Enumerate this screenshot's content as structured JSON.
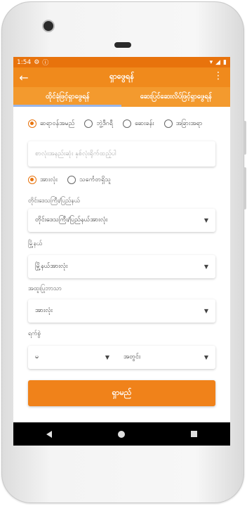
{
  "status": {
    "time": "1:54",
    "icons_left": [
      "gear-icon",
      "info-icon"
    ],
    "icons_right": [
      "wifi-icon",
      "signal-icon",
      "battery-icon"
    ]
  },
  "appbar": {
    "title": "ရှာဖွေရန်"
  },
  "tabs": [
    {
      "label": "ထိုင်ခုံဖြင့်ရှာဖွေရန်",
      "selected": true
    },
    {
      "label": "ဆေးပြင်ဆေးလိပ်ဖြင့်ရှာဖွေရန်",
      "selected": false
    }
  ],
  "search_type": {
    "options": [
      "ဆရာဝန်အမည်",
      "ဘွဲ့ဒီဂရီ",
      "ဆေးခန်း",
      "အခြားအရာ"
    ],
    "selected_index": 0
  },
  "search": {
    "placeholder": "စာလုံးအနည်းဆုံး နှစ်လုံးရိုက်ထည့်ပါ"
  },
  "scope": {
    "options": [
      "အားလုံး",
      "သင်္ကေတရှိသူ"
    ],
    "selected_index": 0
  },
  "state_region": {
    "label": "တိုင်းဒေသကြီး/ပြည်နယ်",
    "value": "တိုင်းဒေသကြီး/ပြည်နယ်အားလုံး"
  },
  "township": {
    "label": "မြို့နယ်",
    "value": "မြို့နယ်အားလုံး"
  },
  "specialty": {
    "label": "အထူးပြုဘာသာ",
    "value": "အားလုံး"
  },
  "date": {
    "label": "ရက်စွဲ",
    "day": "မ",
    "time": "အတွင်း"
  },
  "search_button": {
    "label": "ရှာမည်"
  },
  "colors": {
    "accent": "#f08a1c",
    "statusbar": "#e8730c",
    "tab_indicator": "#9ab6e8"
  }
}
